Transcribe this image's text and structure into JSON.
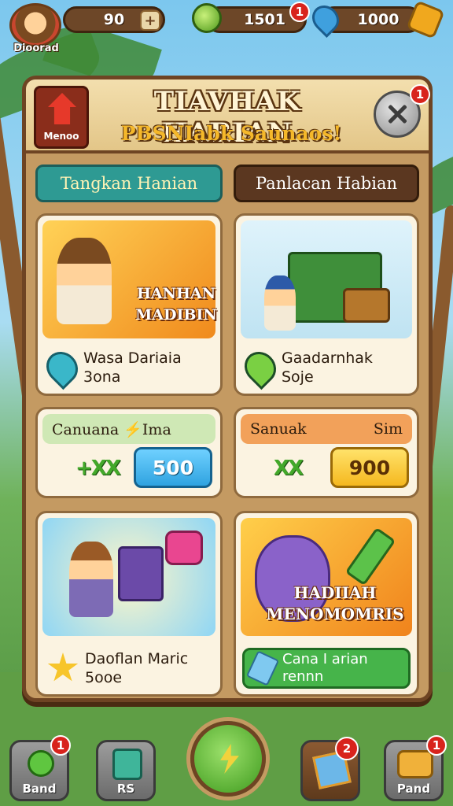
{
  "topbar": {
    "avatar_name": "Dioorad",
    "coins": "90",
    "coin_plus": "+",
    "gems": "1501",
    "gems_badge": "1",
    "energy": "1000"
  },
  "header": {
    "home_label": "Menoo",
    "title": "TIAVHAK HARIAN",
    "subtitle": "PBSNIabk Saunaos!",
    "close_badge": "1"
  },
  "tabs": [
    {
      "label": "Tangkan Hanian"
    },
    {
      "label": "Panlacan Habian"
    }
  ],
  "cards": [
    {
      "art_label": "HANHAN\nMADIBIN",
      "caption": "Wasa Dariaia\n3ona"
    },
    {
      "art_label": "",
      "caption": "Gaadarnhak\nSoje"
    },
    {
      "art_label": "",
      "caption": "Daoflan Maric\n5ooe"
    },
    {
      "art_label": "HADIIAH\nMENOMOMRIS",
      "caption": "Cana I arian\nrennn"
    }
  ],
  "rewards": [
    {
      "title": "Canuana ⚡Ima",
      "multiplier": "+XX",
      "amount": "500"
    },
    {
      "title": "Sanuak",
      "title_right": "Sim",
      "multiplier": "XX",
      "amount": "900"
    }
  ],
  "nav": {
    "left1": {
      "label": "Band",
      "badge": "1"
    },
    "left2": {
      "label": "RS"
    },
    "right1": {
      "badge": "2"
    },
    "right2": {
      "label": "Pand",
      "badge": "1"
    }
  },
  "colors": {
    "panel": "#c49a62",
    "tab_active": "#2e9a93",
    "tab_inactive": "#5b3720",
    "reward_blue": "#2fa3e0",
    "reward_gold": "#f5b81f",
    "badge_red": "#d8231c"
  }
}
